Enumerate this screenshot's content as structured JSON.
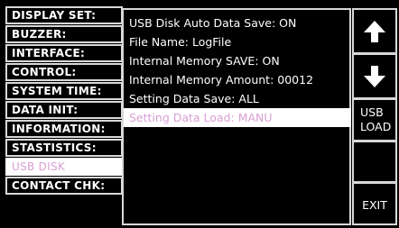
{
  "menu": {
    "items": [
      {
        "label": "DISPLAY SET:"
      },
      {
        "label": "BUZZER:"
      },
      {
        "label": "INTERFACE:"
      },
      {
        "label": "CONTROL:"
      },
      {
        "label": "SYSTEM TIME:"
      },
      {
        "label": "DATA INIT:"
      },
      {
        "label": "INFORMATION:"
      },
      {
        "label": "STASTISTICS:"
      },
      {
        "label": "USB DISK"
      },
      {
        "label": "CONTACT CHK:"
      }
    ],
    "active_index": 8
  },
  "panel": {
    "lines": [
      {
        "text": "USB Disk Auto Data Save: ON"
      },
      {
        "text": "File Name: LogFile"
      },
      {
        "text": "Internal Memory SAVE: ON"
      },
      {
        "text": "Internal Memory Amount: 00012"
      },
      {
        "text": "Setting Data Save: ALL"
      },
      {
        "text": "Setting Data Load: MANU"
      }
    ],
    "active_index": 5
  },
  "softkeys": {
    "up_icon": "arrow-up-icon",
    "down_icon": "arrow-down-icon",
    "usb_load_label": "USB\nLOAD",
    "exit_label": "EXIT"
  },
  "colors": {
    "background": "#000000",
    "border": "#d8d8d8",
    "highlight_bg": "#ffffff",
    "highlight_text": "#d9a0d4"
  }
}
